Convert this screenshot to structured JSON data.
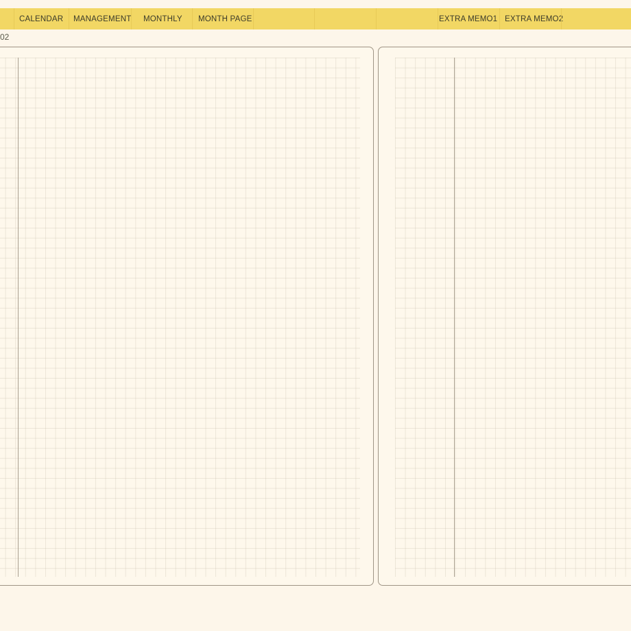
{
  "tabs": {
    "calendar": "CALENDAR",
    "management": "MANAGEMENT",
    "monthly": "MONTHLY",
    "month_page": "MONTH PAGE",
    "extra_memo1": "EXTRA MEMO1",
    "extra_memo2": "EXTRA MEMO2"
  },
  "page_number": "02",
  "colors": {
    "tab_bar": "#f2d764",
    "paper": "#fdf6ea",
    "panel_border": "#9e9485"
  }
}
